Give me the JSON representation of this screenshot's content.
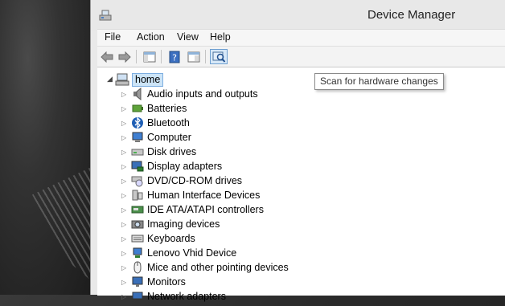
{
  "window": {
    "title": "Device Manager"
  },
  "menu": [
    "File",
    "Action",
    "View",
    "Help"
  ],
  "toolbar": {
    "tooltip": "Scan for hardware changes"
  },
  "tree": {
    "root": "home",
    "items": [
      {
        "label": "Audio inputs and outputs",
        "icon": "speaker-icon"
      },
      {
        "label": "Batteries",
        "icon": "battery-icon"
      },
      {
        "label": "Bluetooth",
        "icon": "bluetooth-icon"
      },
      {
        "label": "Computer",
        "icon": "computer-icon"
      },
      {
        "label": "Disk drives",
        "icon": "disk-drive-icon"
      },
      {
        "label": "Display adapters",
        "icon": "display-adapter-icon"
      },
      {
        "label": "DVD/CD-ROM drives",
        "icon": "dvd-drive-icon"
      },
      {
        "label": "Human Interface Devices",
        "icon": "hid-icon"
      },
      {
        "label": "IDE ATA/ATAPI controllers",
        "icon": "ide-controller-icon"
      },
      {
        "label": "Imaging devices",
        "icon": "camera-icon"
      },
      {
        "label": "Keyboards",
        "icon": "keyboard-icon"
      },
      {
        "label": "Lenovo Vhid Device",
        "icon": "device-icon"
      },
      {
        "label": "Mice and other pointing devices",
        "icon": "mouse-icon"
      },
      {
        "label": "Monitors",
        "icon": "monitor-icon"
      },
      {
        "label": "Network adapters",
        "icon": "network-adapter-icon"
      }
    ]
  }
}
